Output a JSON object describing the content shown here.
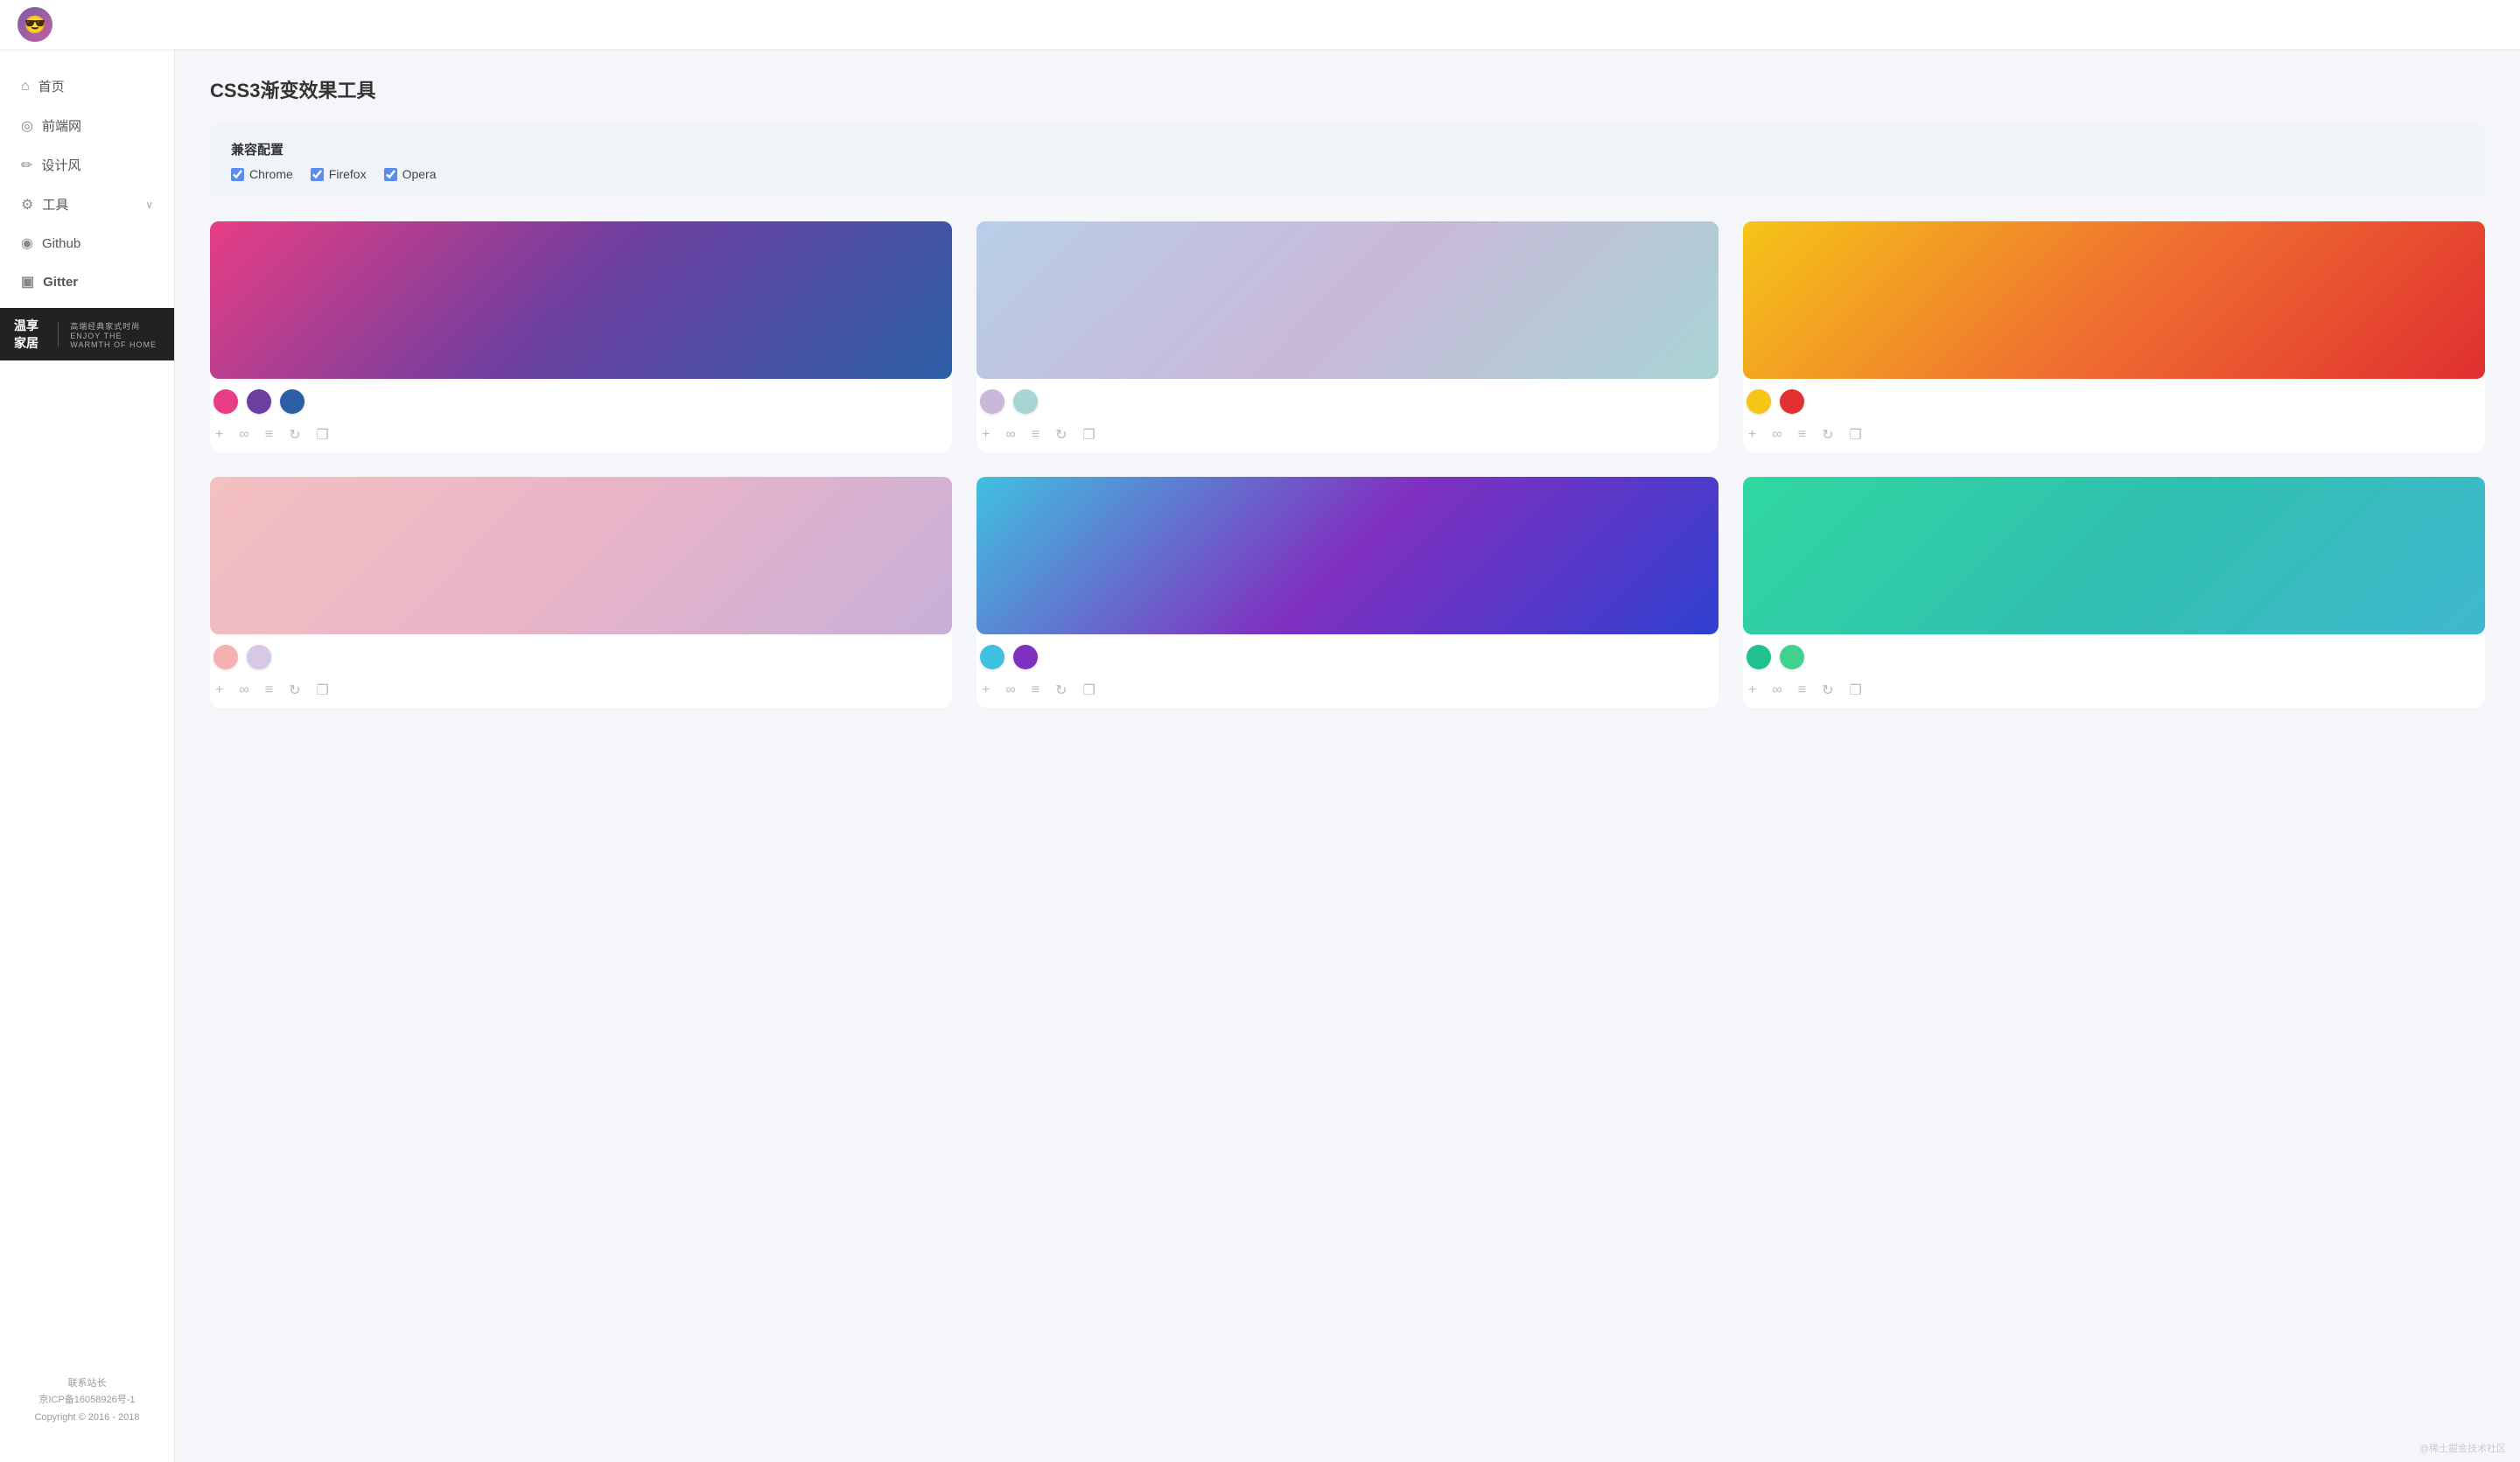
{
  "header": {
    "logo_emoji": "😎"
  },
  "sidebar": {
    "items": [
      {
        "id": "home",
        "label": "首页",
        "icon": "⌂",
        "arrow": false
      },
      {
        "id": "frontend",
        "label": "前端网",
        "icon": "◎",
        "arrow": false
      },
      {
        "id": "design",
        "label": "设计风",
        "icon": "✏",
        "arrow": false
      },
      {
        "id": "tools",
        "label": "工具",
        "icon": "⚙",
        "arrow": true
      },
      {
        "id": "github",
        "label": "Github",
        "icon": "◉",
        "arrow": false
      },
      {
        "id": "gitter",
        "label": "Gitter",
        "icon": "▣",
        "arrow": false,
        "bold": true
      }
    ],
    "banner": {
      "title": "温享家居",
      "subtitle": "高端经典家式时尚",
      "subtitle2": "ENJOY THE WARMTH OF HOME"
    },
    "footer": {
      "contact": "联系站长",
      "icp": "京ICP备16058926号-1",
      "copyright": "Copyright © 2016 - 2018"
    }
  },
  "main": {
    "page_title": "CSS3渐变效果工具",
    "compat_section": {
      "title": "兼容配置",
      "options": [
        {
          "id": "chrome",
          "label": "Chrome",
          "checked": true
        },
        {
          "id": "firefox",
          "label": "Firefox",
          "checked": true
        },
        {
          "id": "opera",
          "label": "Opera",
          "checked": true
        }
      ]
    },
    "gradients": [
      {
        "id": "g1",
        "gradient": "linear-gradient(135deg, #e83d84 0%, #6b3fa0 50%, #2b5fa5 100%)",
        "colors": [
          "#e83d84",
          "#6b3fa0",
          "#2b5fa5"
        ]
      },
      {
        "id": "g2",
        "gradient": "linear-gradient(135deg, #b8cfe8 0%, #c9b8d8 50%, #a8d4d4 100%)",
        "colors": [
          "#c9b8d8",
          "#a8d4d4"
        ]
      },
      {
        "id": "g3",
        "gradient": "linear-gradient(135deg, #f5c518 0%, #f07030 50%, #e03030 100%)",
        "colors": [
          "#f5c518",
          "#e03030"
        ]
      },
      {
        "id": "g4",
        "gradient": "linear-gradient(135deg, #f5c0c0 0%, #e8b4c8 50%, #c8b0d8 100%)",
        "colors": [
          "#f5b0b0",
          "#d8c8e8"
        ]
      },
      {
        "id": "g5",
        "gradient": "linear-gradient(135deg, #40c0e0 0%, #8030c0 50%, #3040d0 100%)",
        "colors": [
          "#40c0e0",
          "#8030c0"
        ]
      },
      {
        "id": "g6",
        "gradient": "linear-gradient(135deg, #30d8a0 0%, #30c0b0 50%, #40b8d0 100%)",
        "colors": [
          "#20c090",
          "#40d090"
        ]
      }
    ],
    "actions": [
      {
        "id": "add",
        "icon": "+",
        "label": "add"
      },
      {
        "id": "infinite",
        "icon": "∞",
        "label": "infinite"
      },
      {
        "id": "settings",
        "icon": "≡",
        "label": "settings"
      },
      {
        "id": "refresh",
        "icon": "↻",
        "label": "refresh"
      },
      {
        "id": "copy",
        "icon": "⧉",
        "label": "copy"
      }
    ]
  },
  "footer": {
    "credit": "@稀土掘金技术社区"
  }
}
